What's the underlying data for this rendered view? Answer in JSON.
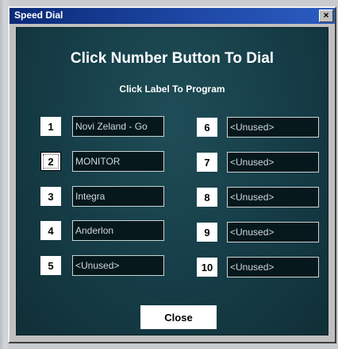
{
  "window": {
    "title": "Speed Dial",
    "close_glyph": "×"
  },
  "heading": "Click Number Button To Dial",
  "subheading": "Click Label To Program",
  "left_column": [
    {
      "number": "1",
      "label": "Novi Zeland - Go"
    },
    {
      "number": "2",
      "label": "MONITOR"
    },
    {
      "number": "3",
      "label": "Integra"
    },
    {
      "number": "4",
      "label": "Anderlon"
    },
    {
      "number": "5",
      "label": "<Unused>"
    }
  ],
  "right_column": [
    {
      "number": "6",
      "label": "<Unused>"
    },
    {
      "number": "7",
      "label": "<Unused>"
    },
    {
      "number": "8",
      "label": "<Unused>"
    },
    {
      "number": "9",
      "label": "<Unused>"
    },
    {
      "number": "10",
      "label": "<Unused>"
    }
  ],
  "close_label": "Close",
  "colors": {
    "title_bar": "#1f4aa8",
    "dialog_background": "#163e48",
    "label_background": "#06181c"
  }
}
